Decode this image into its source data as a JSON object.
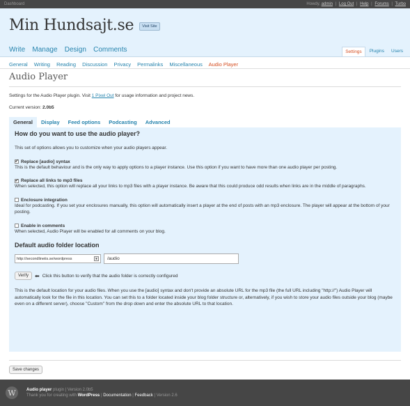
{
  "topbar": {
    "left": "Dashboard",
    "howdy": "Howdy,",
    "user": "admin",
    "links": [
      "Log Out",
      "Help",
      "Forums",
      "Turbo"
    ]
  },
  "header": {
    "site_title": "Min Hundsajt.se",
    "visit_site": "Visit Site"
  },
  "mainnav": {
    "items": [
      "Write",
      "Manage",
      "Design",
      "Comments"
    ],
    "right": [
      "Settings",
      "Plugins",
      "Users"
    ]
  },
  "subnav": {
    "items": [
      "General",
      "Writing",
      "Reading",
      "Discussion",
      "Privacy",
      "Permalinks",
      "Miscellaneous",
      "Audio Player"
    ],
    "active": "Audio Player"
  },
  "page": {
    "title": "Audio Player",
    "desc_before": "Settings for the Audio Player plugin. Visit ",
    "desc_link": "1 Pixel Out",
    "desc_after": " for usage information and project news.",
    "version_label": "Current version: ",
    "version": "2.0b5"
  },
  "tabs": [
    "General",
    "Display",
    "Feed options",
    "Podcasting",
    "Advanced"
  ],
  "general": {
    "heading": "How do you want to use the audio player?",
    "intro": "This set of options allows you to customize when your audio players appear.",
    "options": [
      {
        "label": "Replace [audio] syntax",
        "checked": true,
        "desc": "This is the default behaviour and is the only way to apply options to a player instance. Use this option if you want to have more than one audio player per posting."
      },
      {
        "label": "Replace all links to mp3 files",
        "checked": true,
        "desc": "When selected, this option will replace all your links to mp3 files with a player instance. Be aware that this could produce odd results when links are in the middle of paragraphs."
      },
      {
        "label": "Enclosure integration",
        "checked": false,
        "desc": "Ideal for podcasting. If you set your enclosures manually, this option will automatically insert a player at the end of posts with an mp3 enclosure. The player will appear at the bottom of your posting."
      },
      {
        "label": "Enable in comments",
        "checked": false,
        "desc": "When selected, Audio Player will be enabled for all comments on your blog."
      }
    ],
    "folder_heading": "Default audio folder location",
    "folder_select": "http://secondlineiis.se/wordpress",
    "folder_value": "/audio",
    "verify_label": "Verify",
    "verify_hint": "Click this button to verify that the audio folder is correctly configured",
    "folder_desc": "This is the default location for your audio files. When you use the [audio] syntax and don't provide an absolute URL for the mp3 file (the full URL including \"http://\") Audio Player will automatically look for the file in this location. You can set this to a folder located inside your blog folder structure or, alternatively, if you wish to store your audio files outside your blog (maybe even on a different server), choose \"Custom\" from the drop down and enter the absolute URL to that location."
  },
  "save_label": "Save changes",
  "footer": {
    "plugin_name": "Audio player",
    "plugin_rest": " plugin | Version 2.0b5",
    "thanks": "Thank you for creating with ",
    "wordpress": "WordPress",
    "documentation": "Documentation",
    "feedback": "Feedback",
    "version": "Version 2.6"
  }
}
